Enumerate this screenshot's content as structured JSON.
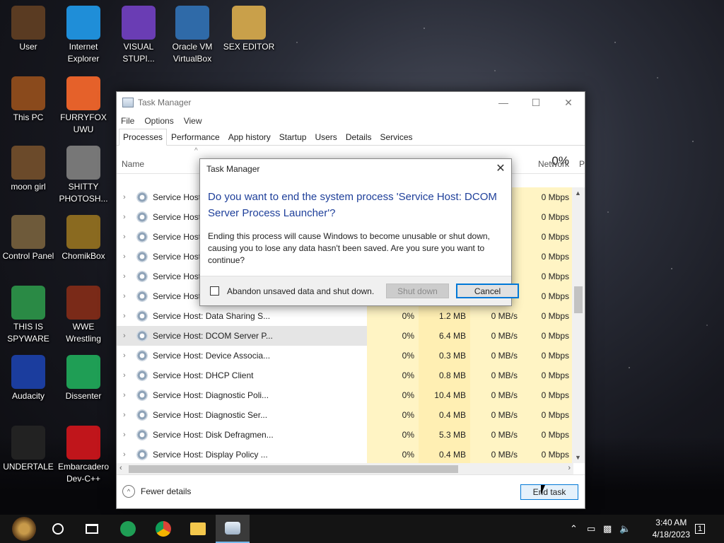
{
  "desktop": {
    "icons": [
      {
        "label": "User",
        "icon": "user-avatar-icon",
        "color": "#5a3b22"
      },
      {
        "label": "Internet Explorer",
        "icon": "edge-browser-icon",
        "color": "#1f8ed8"
      },
      {
        "label": "VISUAL STUPI...",
        "icon": "visual-studio-icon",
        "color": "#6a3db4"
      },
      {
        "label": "Oracle VM VirtualBox",
        "icon": "virtualbox-icon",
        "color": "#2f6aa8"
      },
      {
        "label": "SEX EDITOR",
        "icon": "hex-editor-icon",
        "color": "#c9a04a"
      },
      {
        "label": "This PC",
        "icon": "computer-icon",
        "color": "#8a4a1c"
      },
      {
        "label": "FURRYFOX UWU",
        "icon": "firefox-icon",
        "color": "#e5612a"
      },
      {
        "label": "moon girl",
        "icon": "image-file-icon",
        "color": "#6b4a2a"
      },
      {
        "label": "SHITTY PHOTOSH...",
        "icon": "gimp-icon",
        "color": "#777777"
      },
      {
        "label": "Control Panel",
        "icon": "control-panel-icon",
        "color": "#6e5a3a"
      },
      {
        "label": "ChomikBox",
        "icon": "chomikbox-icon",
        "color": "#8a6a20"
      },
      {
        "label": "THIS IS SPYWARE",
        "icon": "chrome-icon",
        "color": "#2a8a45"
      },
      {
        "label": "WWE Wrestling",
        "icon": "game-icon",
        "color": "#7a2a18"
      },
      {
        "label": "Audacity",
        "icon": "audacity-icon",
        "color": "#1b3d9e"
      },
      {
        "label": "Dissenter",
        "icon": "dissenter-icon",
        "color": "#1f9e55"
      },
      {
        "label": "UNDERTALE",
        "icon": "unity-icon",
        "color": "#222222"
      },
      {
        "label": "Embarcadero Dev-C++",
        "icon": "devcpp-icon",
        "color": "#c0151b"
      }
    ]
  },
  "taskmanager": {
    "title": "Task Manager",
    "menu": [
      "File",
      "Options",
      "View"
    ],
    "tabs": [
      "Processes",
      "Performance",
      "App history",
      "Startup",
      "Users",
      "Details",
      "Services"
    ],
    "header": {
      "name": "Name",
      "network_pct": "0%",
      "network": "Network",
      "power": "P"
    },
    "rows": [
      {
        "name": "Service Host",
        "cpu": "",
        "mem": "",
        "disk": "",
        "net": "0 Mbps"
      },
      {
        "name": "Service Host",
        "cpu": "",
        "mem": "",
        "disk": "",
        "net": "0 Mbps"
      },
      {
        "name": "Service Host",
        "cpu": "",
        "mem": "",
        "disk": "",
        "net": "0 Mbps"
      },
      {
        "name": "Service Host",
        "cpu": "",
        "mem": "",
        "disk": "",
        "net": "0 Mbps"
      },
      {
        "name": "Service Host",
        "cpu": "",
        "mem": "",
        "disk": "",
        "net": "0 Mbps"
      },
      {
        "name": "Service Host",
        "cpu": "",
        "mem": "",
        "disk": "",
        "net": "0 Mbps"
      },
      {
        "name": "Service Host: Data Sharing S...",
        "cpu": "0%",
        "mem": "1.2 MB",
        "disk": "0 MB/s",
        "net": "0 Mbps"
      },
      {
        "name": "Service Host: DCOM Server P...",
        "cpu": "0%",
        "mem": "6.4 MB",
        "disk": "0 MB/s",
        "net": "0 Mbps",
        "selected": true
      },
      {
        "name": "Service Host: Device Associa...",
        "cpu": "0%",
        "mem": "0.3 MB",
        "disk": "0 MB/s",
        "net": "0 Mbps"
      },
      {
        "name": "Service Host: DHCP Client",
        "cpu": "0%",
        "mem": "0.8 MB",
        "disk": "0 MB/s",
        "net": "0 Mbps"
      },
      {
        "name": "Service Host: Diagnostic Poli...",
        "cpu": "0%",
        "mem": "10.4 MB",
        "disk": "0 MB/s",
        "net": "0 Mbps"
      },
      {
        "name": "Service Host: Diagnostic Ser...",
        "cpu": "0%",
        "mem": "0.4 MB",
        "disk": "0 MB/s",
        "net": "0 Mbps"
      },
      {
        "name": "Service Host: Disk Defragmen...",
        "cpu": "0%",
        "mem": "5.3 MB",
        "disk": "0 MB/s",
        "net": "0 Mbps"
      },
      {
        "name": "Service Host: Display Policy ...",
        "cpu": "0%",
        "mem": "0.4 MB",
        "disk": "0 MB/s",
        "net": "0 Mbps"
      }
    ],
    "fewer_details": "Fewer details",
    "end_task": "End task"
  },
  "dialog": {
    "title": "Task Manager",
    "heading": "Do you want to end the system process 'Service Host: DCOM Server Process Launcher'?",
    "body": "Ending this process will cause Windows to become unusable or shut down, causing you to lose any data hasn't been saved. Are you sure you want to continue?",
    "checkbox_label": "Abandon unsaved data and shut down.",
    "shutdown_label": "Shut down",
    "cancel_label": "Cancel"
  },
  "taskbar": {
    "time": "3:40 AM",
    "date": "4/18/2023",
    "notification_count": "1"
  }
}
